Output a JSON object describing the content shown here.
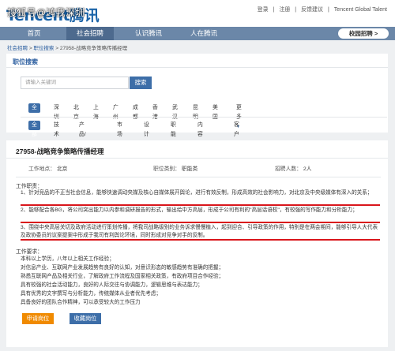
{
  "brand": {
    "logo_text": "Tencent腾讯",
    "watermark": "搜狐号@鸿我深圳"
  },
  "top_links": [
    "登录",
    "|",
    "注册",
    "|",
    "反馈建议",
    "|",
    "Tencent Global Talent"
  ],
  "nav": {
    "items": [
      "首页",
      "社会招聘",
      "认识腾讯",
      "人在腾讯"
    ],
    "active_index": 1,
    "school_button": "校园招聘 >"
  },
  "breadcrumb": {
    "home": "社会招聘",
    "sep": ">",
    "section": "职位搜索",
    "current": "27958-战略竞争策略传播经理"
  },
  "search": {
    "title": "职位搜索",
    "placeholder": "请输入关键词",
    "button": "搜索",
    "locations": [
      "全部",
      "深圳",
      "北京",
      "上海",
      "广州",
      "成都",
      "香港",
      "武汉",
      "昆明",
      "美国"
    ],
    "more": "更多",
    "categories": [
      "全部",
      "技术类",
      "产品/项目类",
      "市场类",
      "设计类",
      "职能类",
      "内容编辑类",
      "客户服务类"
    ]
  },
  "job": {
    "title": "27958-战略竞争策略传播经理",
    "location_label": "工作地点：",
    "location": "北京",
    "category_label": "职位类别：",
    "category": "职能类",
    "headcount_label": "招聘人数：",
    "headcount": "2人",
    "duties_title": "工作职责：",
    "duties": [
      "1、针对竞品的不正当社会信息，能够快速调动央媒及核心自媒体展开舆论，进行有效反制，形成高效的社会影响力，对北京及中央级媒体有深入的关系；",
      "2、能够配合各BG，将公司突出能力以内参和调研报告的形式，输出给中方高层，形成于公司有利的\"高层话语权\"，有较强的写作能力和分析能力；",
      "3、围绕中央高层关切及政府活动进行策划传播，将我司战略级别的业务诉求慢慢植入，起到迎合、引导政策的作用，特别是在两会期间，能够引导人大代表及政协委员的议案提案中形成于我司有利舆论环境，同时形成对竞争对手的反制。"
    ],
    "requirements_title": "工作要求：",
    "requirements": [
      "本科以上学历，八年以上相关工作经验；",
      "对信息产业、互联网产业发展趋势有良好的认知，对意识形态的敏感趋势有准确的把握；",
      "熟悉互联网产品及相关行业，了解政府工作流程及国家相关政策，有政府项目合作经验；",
      "具有较强的社会活动能力，良好的人际交往与协调能力，逻辑思维与表达能力；",
      "具有优秀的文字撰写与分析能力，传统媒体从业者优先考虑；",
      "具备良好的团队合作精神，可以承受较大的工作压力"
    ],
    "apply_button": "申请岗位",
    "favorite_button": "收藏岗位"
  },
  "colors": {
    "primary": "#3d6ea8",
    "nav_bar": "#6b87a8",
    "apply": "#f08a00",
    "annotation_red": "#d9161c"
  }
}
